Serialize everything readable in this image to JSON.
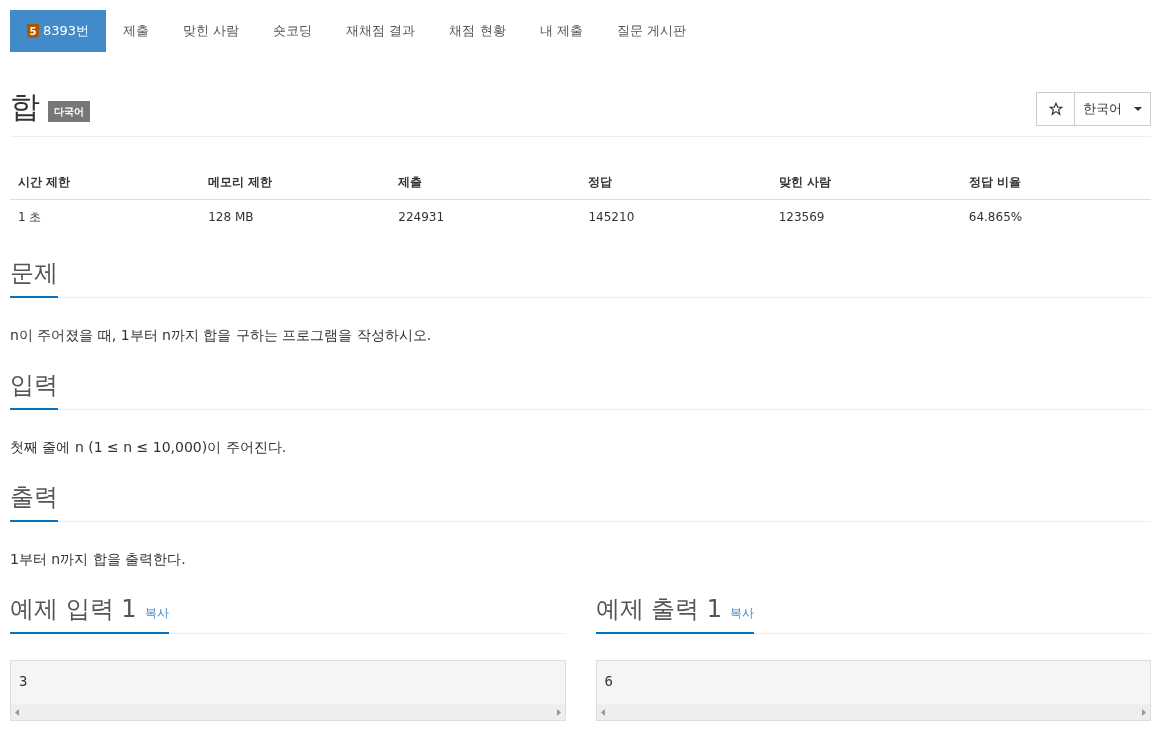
{
  "tabs": [
    {
      "label": "8393번",
      "tier": "5",
      "selected": true
    },
    {
      "label": "제출",
      "selected": false
    },
    {
      "label": "맞힌 사람",
      "selected": false
    },
    {
      "label": "숏코딩",
      "selected": false
    },
    {
      "label": "재채점 결과",
      "selected": false
    },
    {
      "label": "채점 현황",
      "selected": false
    },
    {
      "label": "내 제출",
      "selected": false
    },
    {
      "label": "질문 게시판",
      "selected": false
    }
  ],
  "problem": {
    "title": "합",
    "badge": "다국어",
    "starred": false,
    "language": "한국어"
  },
  "table": {
    "columns": [
      "시간 제한",
      "메모리 제한",
      "제출",
      "정답",
      "맞힌 사람",
      "정답 비율"
    ],
    "rows": [
      [
        "1 초",
        "128 MB",
        "224931",
        "145210",
        "123569",
        "64.865%"
      ]
    ]
  },
  "sections": [
    {
      "heading": "문제",
      "body": "n이 주어졌을 때, 1부터 n까지 합을 구하는 프로그램을 작성하시오."
    },
    {
      "heading": "입력",
      "body": "첫째 줄에 n (1 ≤ n ≤ 10,000)이 주어진다."
    },
    {
      "heading": "출력",
      "body": "1부터 n까지 합을 출력한다."
    }
  ],
  "samples": [
    {
      "heading": "예제 입력 1",
      "copy": "복사",
      "content": "3"
    },
    {
      "heading": "예제 출력 1",
      "copy": "복사",
      "content": "6"
    }
  ]
}
